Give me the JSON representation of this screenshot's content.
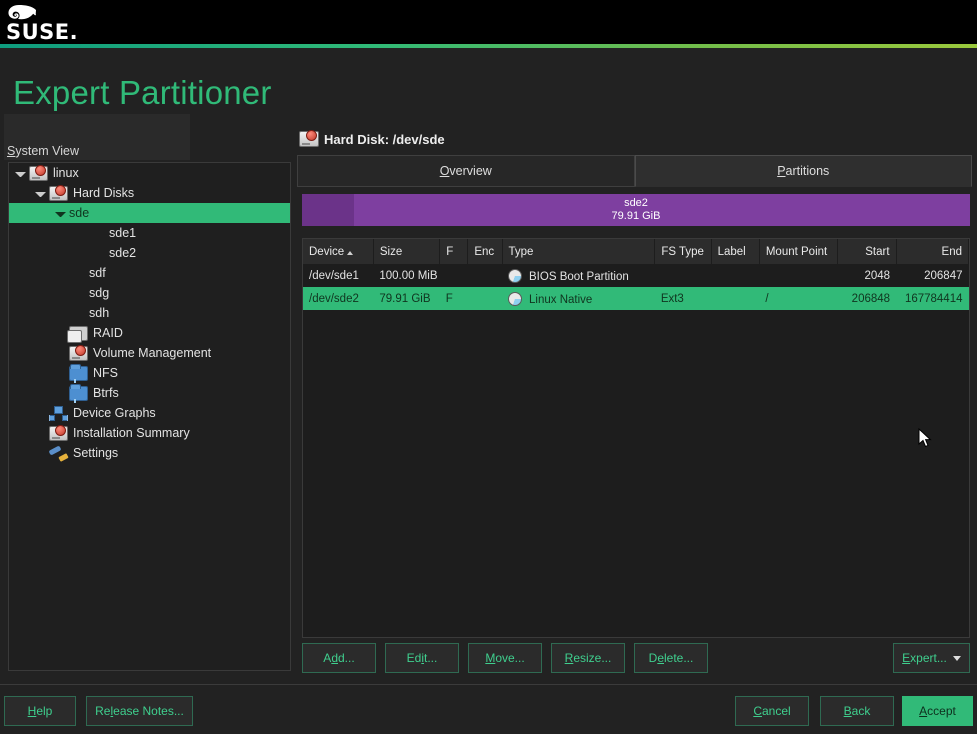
{
  "app": {
    "brand": "SUSE",
    "page_title": "Expert Partitioner",
    "accent_color": "#30ba78",
    "selection_color": "#31ba78"
  },
  "sidebar": {
    "label": "System View",
    "label_accesskey": "S",
    "items": [
      {
        "label": "linux",
        "icon": "disk-icon",
        "indent": 0,
        "twisty": "down",
        "selected": false
      },
      {
        "label": "Hard Disks",
        "icon": "disk-icon",
        "indent": 1,
        "twisty": "down",
        "selected": false
      },
      {
        "label": "sde",
        "icon": "none",
        "indent": 2,
        "twisty": "down",
        "selected": true
      },
      {
        "label": "sde1",
        "icon": "none",
        "indent": 4,
        "twisty": "none",
        "selected": false
      },
      {
        "label": "sde2",
        "icon": "none",
        "indent": 4,
        "twisty": "none",
        "selected": false
      },
      {
        "label": "sdf",
        "icon": "none",
        "indent": 3,
        "twisty": "none",
        "selected": false
      },
      {
        "label": "sdg",
        "icon": "none",
        "indent": 3,
        "twisty": "none",
        "selected": false
      },
      {
        "label": "sdh",
        "icon": "none",
        "indent": 3,
        "twisty": "none",
        "selected": false
      },
      {
        "label": "RAID",
        "icon": "raid-icon",
        "indent": 2,
        "twisty": "none",
        "selected": false
      },
      {
        "label": "Volume Management",
        "icon": "disk-icon",
        "indent": 2,
        "twisty": "none",
        "selected": false
      },
      {
        "label": "NFS",
        "icon": "folder-icon",
        "indent": 2,
        "twisty": "none",
        "selected": false
      },
      {
        "label": "Btrfs",
        "icon": "folder-icon",
        "indent": 2,
        "twisty": "none",
        "selected": false
      },
      {
        "label": "Device Graphs",
        "icon": "device-graph-icon",
        "indent": 1,
        "twisty": "none",
        "selected": false
      },
      {
        "label": "Installation Summary",
        "icon": "disk-icon",
        "indent": 1,
        "twisty": "none",
        "selected": false
      },
      {
        "label": "Settings",
        "icon": "wrench-icon",
        "indent": 1,
        "twisty": "none",
        "selected": false
      }
    ]
  },
  "main": {
    "disk_heading": "Hard Disk: /dev/sde",
    "tabs": [
      {
        "label": "Overview",
        "accesskey": "O",
        "active": false
      },
      {
        "label": "Partitions",
        "accesskey": "P",
        "active": true
      }
    ],
    "graph_bar": {
      "name": "sde2",
      "size": "79.91 GiB",
      "color": "#7e3fa0",
      "leading_segment_color": "#6b3389"
    },
    "table": {
      "columns": [
        "Device",
        "Size",
        "F",
        "Enc",
        "Type",
        "FS Type",
        "Label",
        "Mount Point",
        "Start",
        "End"
      ],
      "sorted_column": "Device",
      "sort_direction": "ascending",
      "rows": [
        {
          "device": "/dev/sde1",
          "size": "100.00 MiB",
          "f": "",
          "enc": "",
          "type": "BIOS Boot Partition",
          "fs_type": "",
          "label": "",
          "mount_point": "",
          "start": "2048",
          "end": "206847",
          "selected": false
        },
        {
          "device": "/dev/sde2",
          "size": "79.91 GiB",
          "f": "F",
          "enc": "",
          "type": "Linux Native",
          "fs_type": "Ext3",
          "label": "",
          "mount_point": "/",
          "start": "206848",
          "end": "167784414",
          "selected": true
        }
      ]
    },
    "actions": [
      {
        "label": "Add...",
        "accesskey": "d"
      },
      {
        "label": "Edit...",
        "accesskey": "i"
      },
      {
        "label": "Move...",
        "accesskey": "M"
      },
      {
        "label": "Resize...",
        "accesskey": "R"
      },
      {
        "label": "Delete...",
        "accesskey": "e"
      }
    ],
    "expert_button": {
      "label": "Expert...",
      "accesskey": "E"
    }
  },
  "footer": {
    "help": "Help",
    "release_notes": "Release Notes...",
    "cancel": "Cancel",
    "back": "Back",
    "accept": "Accept"
  }
}
